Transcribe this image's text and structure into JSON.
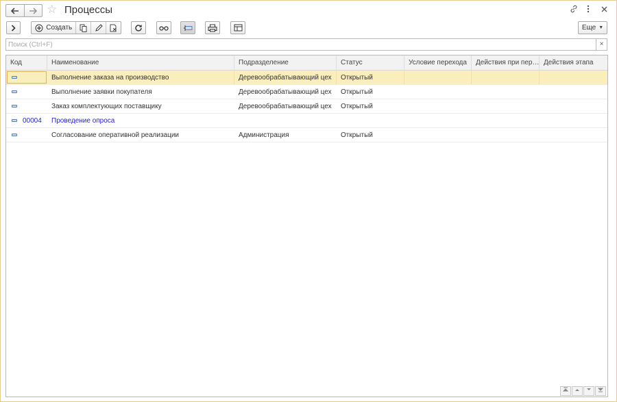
{
  "window": {
    "title": "Процессы",
    "nav_back_icon": "arrow-left-icon",
    "nav_forward_icon": "arrow-right-icon",
    "favorite_icon": "star-icon",
    "link_icon": "link-icon",
    "menu_icon": "more-vertical-icon",
    "close_icon": "close-icon"
  },
  "toolbar": {
    "create_label": "Создать",
    "more_label": "Еще"
  },
  "search": {
    "placeholder": "Поиск (Ctrl+F)",
    "clear_symbol": "×"
  },
  "table": {
    "columns": [
      "Код",
      "Наименование",
      "Подразделение",
      "Статус",
      "Условие перехода",
      "Действия при пер…",
      "Действия этапа"
    ],
    "rows": [
      {
        "code": "",
        "name": "Выполнение заказа на производство",
        "department": "Деревообрабатывающий цех",
        "status": "Открытый",
        "selected": true
      },
      {
        "code": "",
        "name": "Выполнение заявки покупателя",
        "department": "Деревообрабатывающий цех",
        "status": "Открытый"
      },
      {
        "code": "",
        "name": "Заказ комплектующих поставщику",
        "department": "Деревообрабатывающий цех",
        "status": "Открытый"
      },
      {
        "code": "00004",
        "name": "Проведение опроса",
        "department": "",
        "status": "",
        "group": true
      },
      {
        "code": "",
        "name": "Согласование оперативной реализации",
        "department": "Администрация",
        "status": "Открытый"
      }
    ]
  },
  "colors": {
    "window_border": "#e8c98a",
    "selected_row": "#fbeebd",
    "group_text": "#2424b8"
  }
}
